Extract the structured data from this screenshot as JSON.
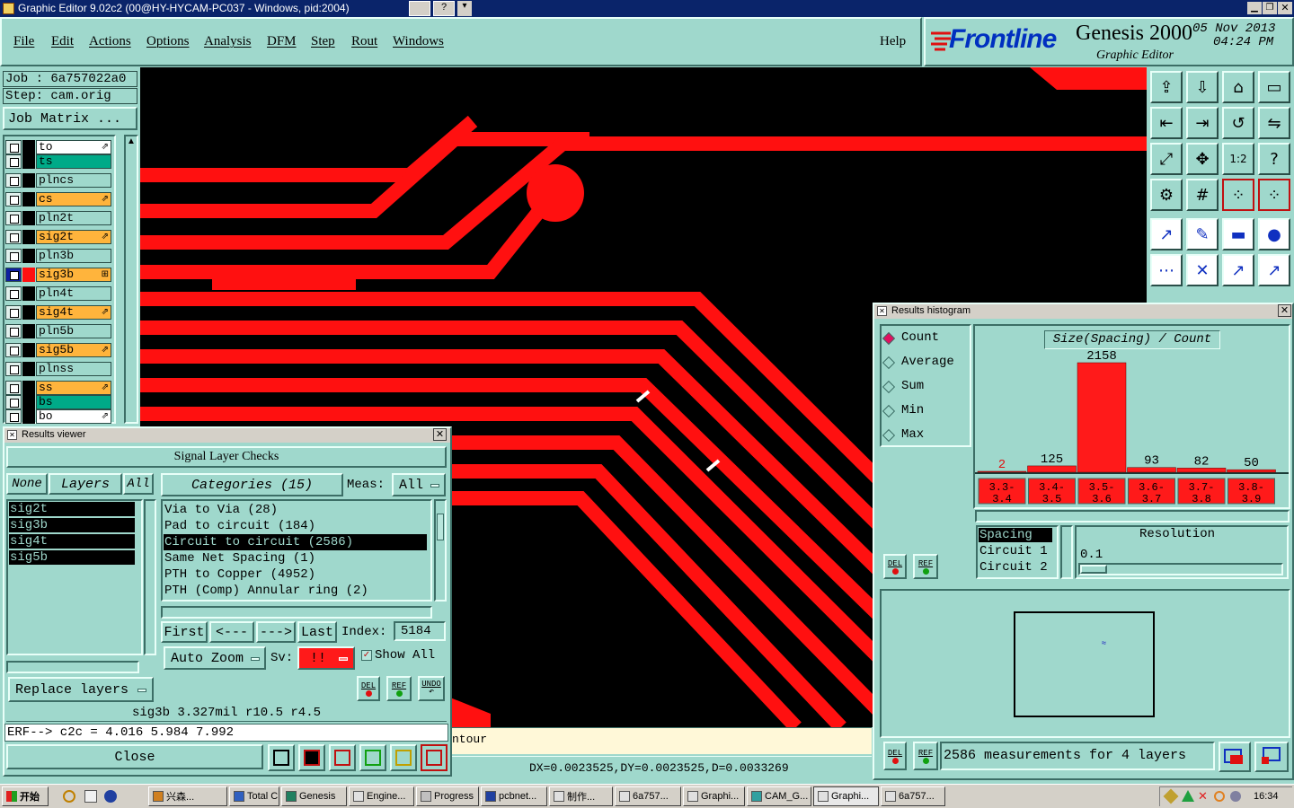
{
  "window": {
    "title": "Graphic Editor 9.02c2 (00@HY-HYCAM-PC037 - Windows, pid:2004)"
  },
  "menu": [
    "File",
    "Edit",
    "Actions",
    "Options",
    "Analysis",
    "DFM",
    "Step",
    "Rout",
    "Windows"
  ],
  "help_label": "Help",
  "brand": {
    "logo": "Frontline",
    "product": "Genesis 2000",
    "subtitle": "Graphic Editor",
    "date": "05 Nov 2013",
    "time": "04:24 PM"
  },
  "job": {
    "job_label": "Job : 6a757022a0",
    "step_label": "Step: cam.orig",
    "matrix_button": "Job Matrix ..."
  },
  "layers": [
    {
      "name": "to",
      "color": "#ffffff",
      "arrow": "⇗"
    },
    {
      "name": "ts",
      "color": "#00aa88",
      "arrow": ""
    },
    {
      "name": "plncs",
      "color": "#9fd8cc",
      "arrow": ""
    },
    {
      "name": "cs",
      "color": "#ffb43c",
      "arrow": "⇗"
    },
    {
      "name": "pln2t",
      "color": "#9fd8cc",
      "arrow": ""
    },
    {
      "name": "sig2t",
      "color": "#ffb43c",
      "arrow": "⇗"
    },
    {
      "name": "pln3b",
      "color": "#9fd8cc",
      "arrow": ""
    },
    {
      "name": "sig3b",
      "color": "#ffb43c",
      "arrow": "⊞"
    },
    {
      "name": "pln4t",
      "color": "#9fd8cc",
      "arrow": ""
    },
    {
      "name": "sig4t",
      "color": "#ffb43c",
      "arrow": "⇗"
    },
    {
      "name": "pln5b",
      "color": "#9fd8cc",
      "arrow": ""
    },
    {
      "name": "sig5b",
      "color": "#ffb43c",
      "arrow": "⇗"
    },
    {
      "name": "plnss",
      "color": "#9fd8cc",
      "arrow": ""
    },
    {
      "name": "ss",
      "color": "#ffb43c",
      "arrow": "⇗"
    },
    {
      "name": "bs",
      "color": "#00aa88",
      "arrow": ""
    },
    {
      "name": "bo",
      "color": "#ffffff",
      "arrow": "⇗"
    }
  ],
  "results_viewer": {
    "title": "Results viewer",
    "header": "Signal Layer Checks",
    "none_btn": "None",
    "layers_btn": "Layers",
    "all_btn": "All",
    "categories_btn": "Categories (15)",
    "meas_label": "Meas:",
    "meas_value": "All",
    "layer_list": [
      "sig2t",
      "sig3b",
      "sig4t",
      "sig5b"
    ],
    "categories": [
      "Via to Via (28)",
      "Pad to circuit (184)",
      "Circuit to circuit (2586)",
      "Same Net Spacing (1)",
      "PTH to Copper (4952)",
      "PTH (Comp) Annular ring (2)"
    ],
    "first": "First",
    "prev": "<---",
    "next": "--->",
    "last": "Last",
    "index_label": "Index:",
    "index_value": "5184",
    "auto_zoom": "Auto Zoom",
    "sv_label": "Sv:",
    "sv_value": "!!",
    "show_all": "Show All",
    "replace_layers": "Replace layers",
    "del_label": "DEL",
    "ref_label": "REF",
    "undo_label": "UNDO",
    "info_line": "sig3b 3.327mil  r10.5  r4.5",
    "erf_line": "ERF--> c2c = 4.016 5.984 7.992",
    "close": "Close"
  },
  "status": {
    "contour_text": "ntour",
    "coords": "DX=0.0023525,DY=0.0023525,D=0.0033269"
  },
  "histogram": {
    "title": "Results histogram",
    "modes": [
      "Count",
      "Average",
      "Sum",
      "Min",
      "Max"
    ],
    "chart_title": "Size(Spacing) / Count",
    "type_list": [
      "Spacing",
      "Circuit 1",
      "Circuit 2"
    ],
    "resolution_label": "Resolution",
    "resolution_value": "0.1",
    "summary": "2586 measurements for 4 layers",
    "del_label": "DEL",
    "ref_label": "REF"
  },
  "chart_data": {
    "type": "bar",
    "title": "Size(Spacing) / Count",
    "categories": [
      "3.3-3.4",
      "3.4-3.5",
      "3.5-3.6",
      "3.6-3.7",
      "3.7-3.8",
      "3.8-3.9"
    ],
    "category_labels_top": [
      "3.3-",
      "3.4-",
      "3.5-",
      "3.6-",
      "3.7-",
      "3.8-"
    ],
    "category_labels_bottom": [
      "3.4",
      "3.5",
      "3.6",
      "3.7",
      "3.8",
      "3.9"
    ],
    "values": [
      2,
      125,
      2158,
      93,
      82,
      50
    ],
    "ylim": [
      0,
      2158
    ],
    "bar_color": "#ff1a1a"
  },
  "taskbar": {
    "start": "开始",
    "tasks": [
      "兴森...",
      "Total C...",
      "Genesis",
      "Engine...",
      "Progress",
      "pcbnet...",
      "制作...",
      "6a757...",
      "Graphi...",
      "CAM_G...",
      "Graphi...",
      "6a757..."
    ],
    "clock": "16:34"
  },
  "colors": {
    "accent_teal": "#9fd8cc",
    "canvas_bg": "#000000",
    "trace_red": "#ff1010",
    "selected_row": "#000000"
  }
}
